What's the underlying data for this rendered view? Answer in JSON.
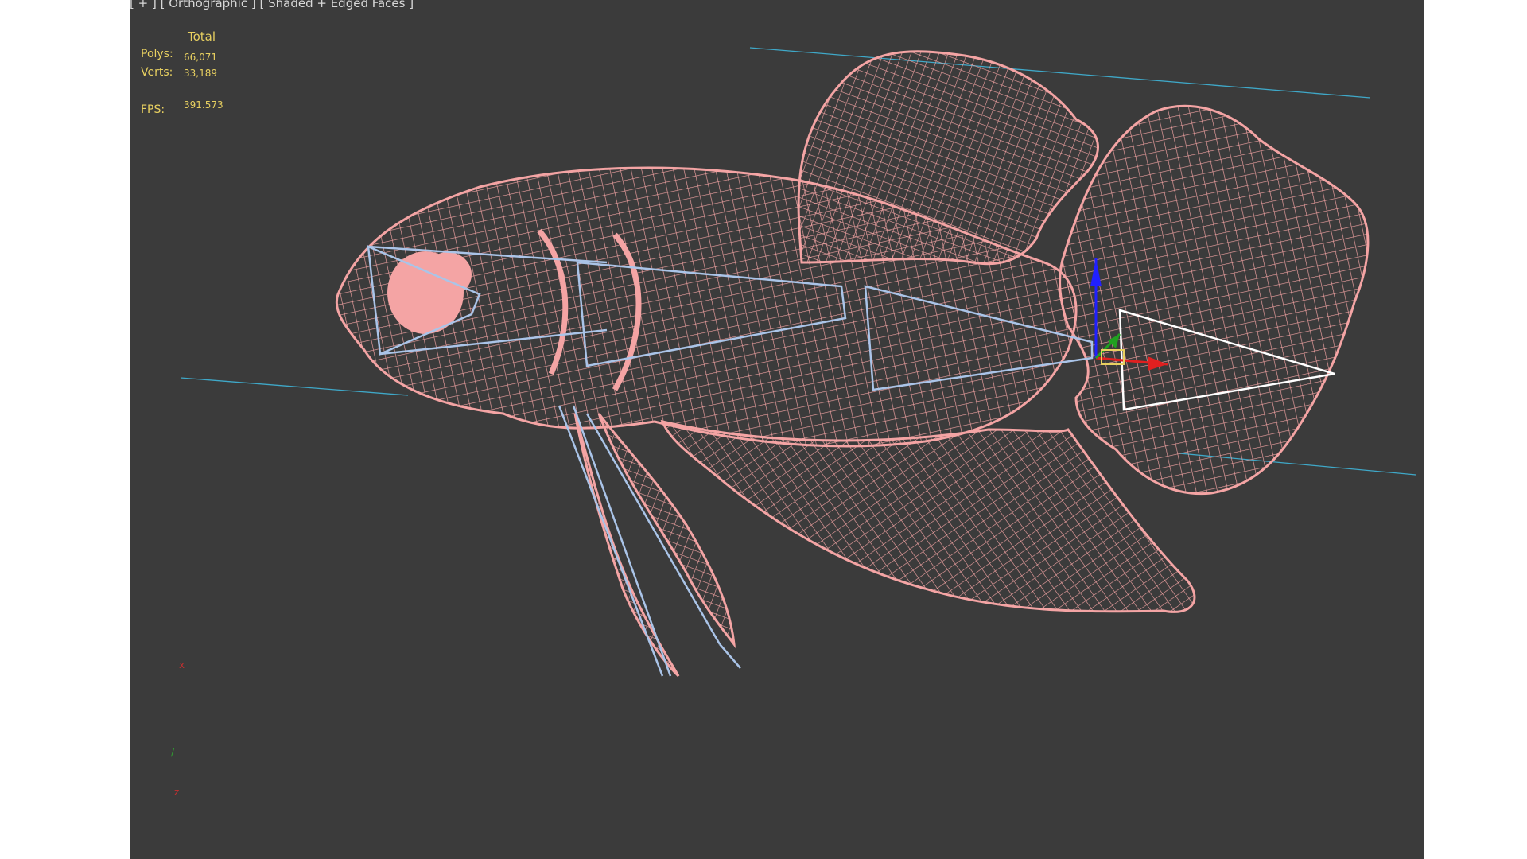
{
  "viewport": {
    "label_plus": "[ + ]",
    "label_view": "[ Orthographic ]",
    "label_shading": "[ Shaded + Edged Faces ]"
  },
  "stats": {
    "total_label": "Total",
    "polys_label": "Polys:",
    "polys_value": "66,071",
    "verts_label": "Verts:",
    "verts_value": "33,189",
    "fps_label": "FPS:",
    "fps_value": "391.573"
  },
  "colors": {
    "viewport_bg": "#3b3b3b",
    "wireframe": "#f4a4a4",
    "bone": "#aac4e8",
    "grid": "#3fa8c8",
    "stats_text": "#e8d060"
  }
}
